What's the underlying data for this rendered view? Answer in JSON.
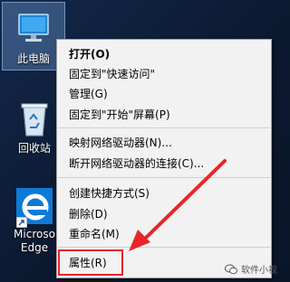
{
  "desktop": {
    "icons": [
      {
        "label": "此电脑"
      },
      {
        "label": "回收站"
      },
      {
        "label_line1": "Microso",
        "label_line2": "Edge"
      }
    ]
  },
  "context_menu": {
    "items": [
      {
        "label": "打开(O)",
        "bold": true
      },
      {
        "label": "固定到\"快速访问\""
      },
      {
        "label": "管理(G)"
      },
      {
        "label": "固定到\"开始\"屏幕(P)"
      },
      {
        "label": "映射网络驱动器(N)..."
      },
      {
        "label": "断开网络驱动器的连接(C)..."
      },
      {
        "label": "创建快捷方式(S)"
      },
      {
        "label": "删除(D)"
      },
      {
        "label": "重命名(M)"
      },
      {
        "label": "属性(R)",
        "highlighted": true
      }
    ]
  },
  "annotation": {
    "color": "#e8252b"
  },
  "watermark": {
    "text": "软件小视"
  }
}
